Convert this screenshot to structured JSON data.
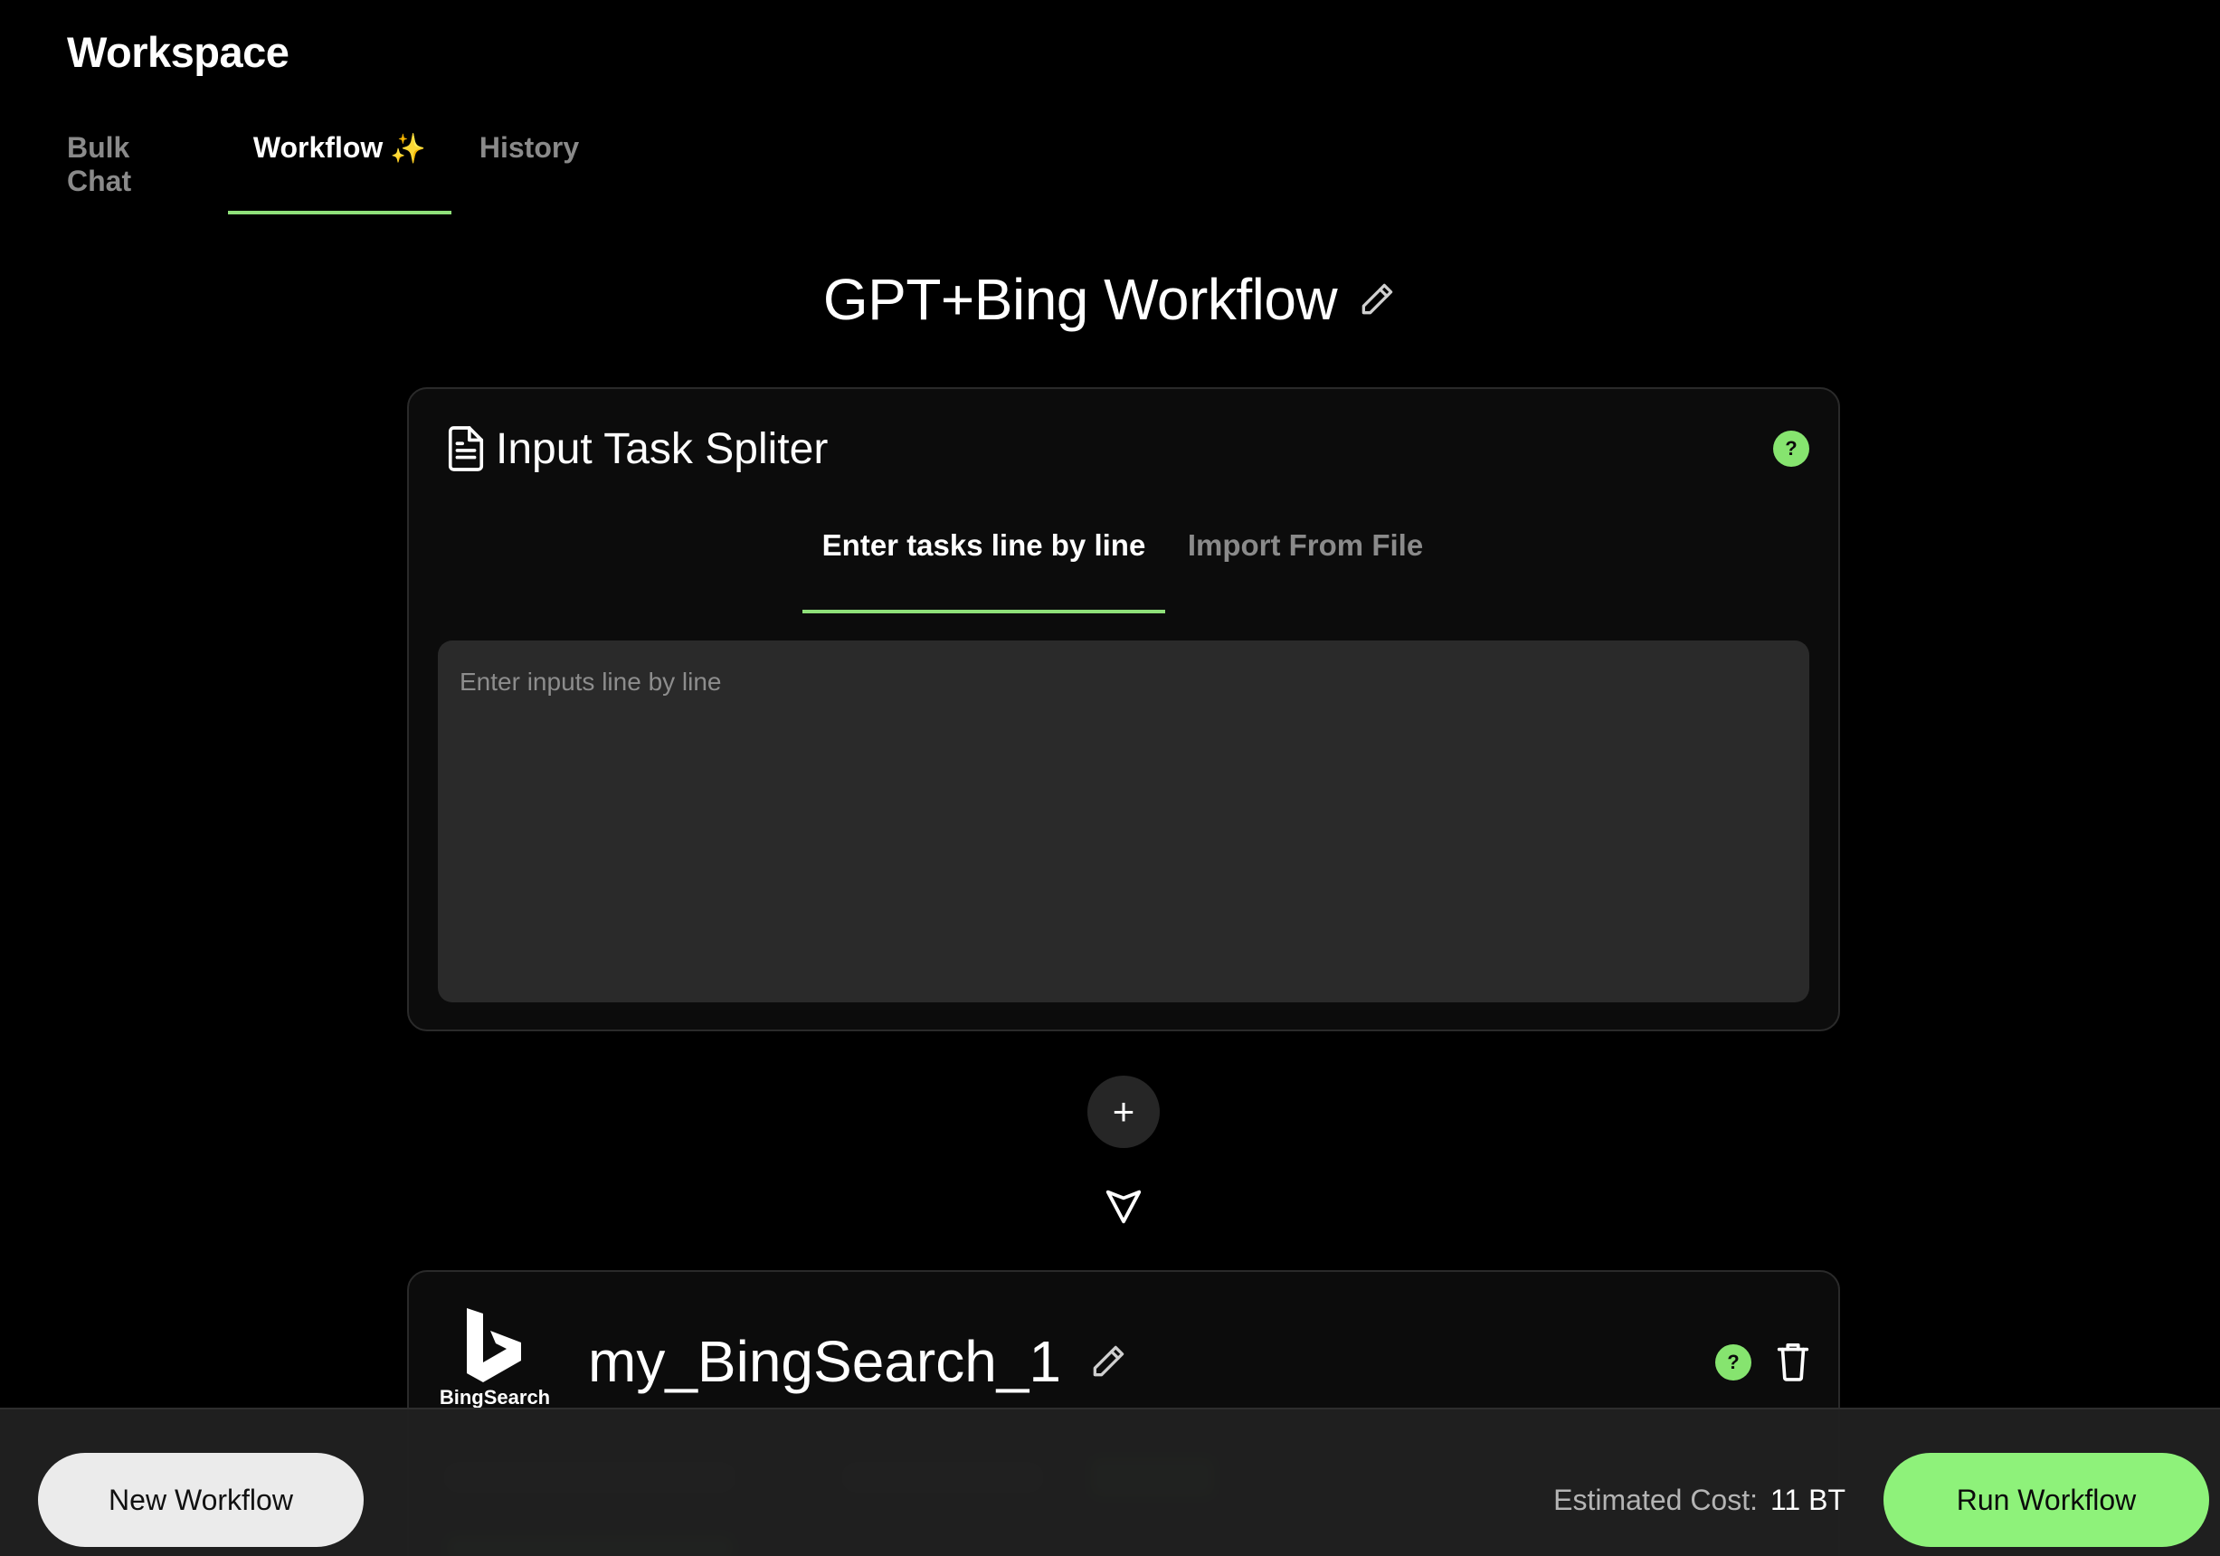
{
  "app": {
    "title": "Workspace"
  },
  "tabs": [
    {
      "label": "Bulk Chat",
      "active": false
    },
    {
      "label": "Workflow",
      "suffix": "✨",
      "active": true
    },
    {
      "label": "History",
      "active": false
    }
  ],
  "workflow": {
    "title": "GPT+Bing Workflow"
  },
  "input_card": {
    "title": "Input Task Spliter",
    "help": "?",
    "subtabs": [
      {
        "label": "Enter tasks line by line",
        "active": true
      },
      {
        "label": "Import From File",
        "active": false
      }
    ],
    "textarea": {
      "placeholder": "Enter inputs line by line",
      "value": ""
    }
  },
  "add_step": {
    "label": "+"
  },
  "bing_card": {
    "logo_label": "BingSearch",
    "name": "my_BingSearch_1",
    "help": "?"
  },
  "bottom_bar": {
    "new_workflow_label": "New Workflow",
    "cost_label": "Estimated Cost:",
    "cost_value": "11 BT",
    "run_workflow_label": "Run Workflow"
  },
  "colors": {
    "accent": "#8ef27a",
    "background": "#000000",
    "card": "#0c0c0c",
    "input": "#2a2a2a"
  }
}
